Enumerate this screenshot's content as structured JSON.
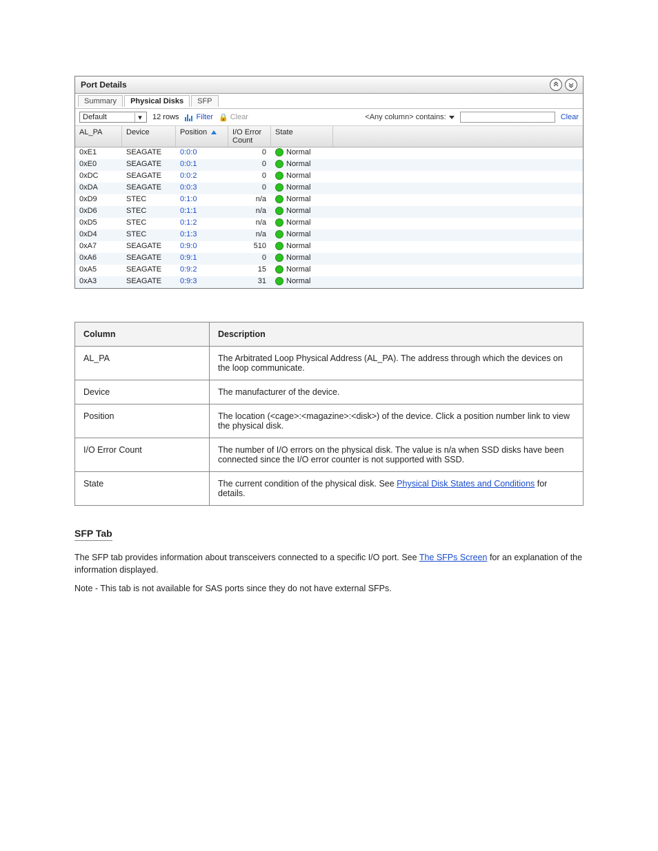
{
  "panel": {
    "title": "Port Details",
    "tabs": {
      "summary": "Summary",
      "physical": "Physical Disks",
      "sfp": "SFP",
      "active": "physical"
    },
    "toolbar": {
      "view_select": "Default",
      "row_count": "12 rows",
      "filter_label": "Filter",
      "clear_label": "Clear",
      "contains_label": "<Any column> contains:",
      "search_value": "",
      "clear_link": "Clear"
    },
    "columns": {
      "alpa": "AL_PA",
      "device": "Device",
      "position": "Position",
      "ioerr": "I/O Error Count",
      "state": "State"
    },
    "rows": [
      {
        "alpa": "0xE1",
        "device": "SEAGATE",
        "position": "0:0:0",
        "ioerr": "0",
        "state": "Normal"
      },
      {
        "alpa": "0xE0",
        "device": "SEAGATE",
        "position": "0:0:1",
        "ioerr": "0",
        "state": "Normal"
      },
      {
        "alpa": "0xDC",
        "device": "SEAGATE",
        "position": "0:0:2",
        "ioerr": "0",
        "state": "Normal"
      },
      {
        "alpa": "0xDA",
        "device": "SEAGATE",
        "position": "0:0:3",
        "ioerr": "0",
        "state": "Normal"
      },
      {
        "alpa": "0xD9",
        "device": "STEC",
        "position": "0:1:0",
        "ioerr": "n/a",
        "state": "Normal"
      },
      {
        "alpa": "0xD6",
        "device": "STEC",
        "position": "0:1:1",
        "ioerr": "n/a",
        "state": "Normal"
      },
      {
        "alpa": "0xD5",
        "device": "STEC",
        "position": "0:1:2",
        "ioerr": "n/a",
        "state": "Normal"
      },
      {
        "alpa": "0xD4",
        "device": "STEC",
        "position": "0:1:3",
        "ioerr": "n/a",
        "state": "Normal"
      },
      {
        "alpa": "0xA7",
        "device": "SEAGATE",
        "position": "0:9:0",
        "ioerr": "510",
        "state": "Normal"
      },
      {
        "alpa": "0xA6",
        "device": "SEAGATE",
        "position": "0:9:1",
        "ioerr": "0",
        "state": "Normal"
      },
      {
        "alpa": "0xA5",
        "device": "SEAGATE",
        "position": "0:9:2",
        "ioerr": "15",
        "state": "Normal"
      },
      {
        "alpa": "0xA3",
        "device": "SEAGATE",
        "position": "0:9:3",
        "ioerr": "31",
        "state": "Normal"
      }
    ]
  },
  "desc": {
    "head_col": "Column",
    "head_desc": "Description",
    "rows": [
      {
        "k": "AL_PA",
        "v": "The Arbitrated Loop Physical Address (AL_PA). The address through which the devices on the loop communicate."
      },
      {
        "k": "Device",
        "v": "The manufacturer of the device."
      },
      {
        "k": "Position",
        "v": "The location (<cage>:<magazine>:<disk>) of the device. Click a position number link to view the physical disk."
      },
      {
        "k": "I/O Error Count",
        "v": "The number of I/O errors on the physical disk. The value is n/a when SSD disks have been connected since the I/O error counter is not supported with SSD."
      },
      {
        "k": "State",
        "v_prefix": "The current condition of the physical disk. See ",
        "v_link_text": "Physical Disk States and Conditions",
        "v_suffix": " for details."
      }
    ]
  },
  "sfp": {
    "title": "SFP Tab",
    "para1_prefix": "The SFP tab provides information about transceivers connected to a specific I/O port. See ",
    "para1_link": "The SFPs Screen",
    "para1_suffix": " for an explanation of the information displayed.",
    "para2": "Note - This tab is not available for SAS ports since they do not have external SFPs."
  }
}
